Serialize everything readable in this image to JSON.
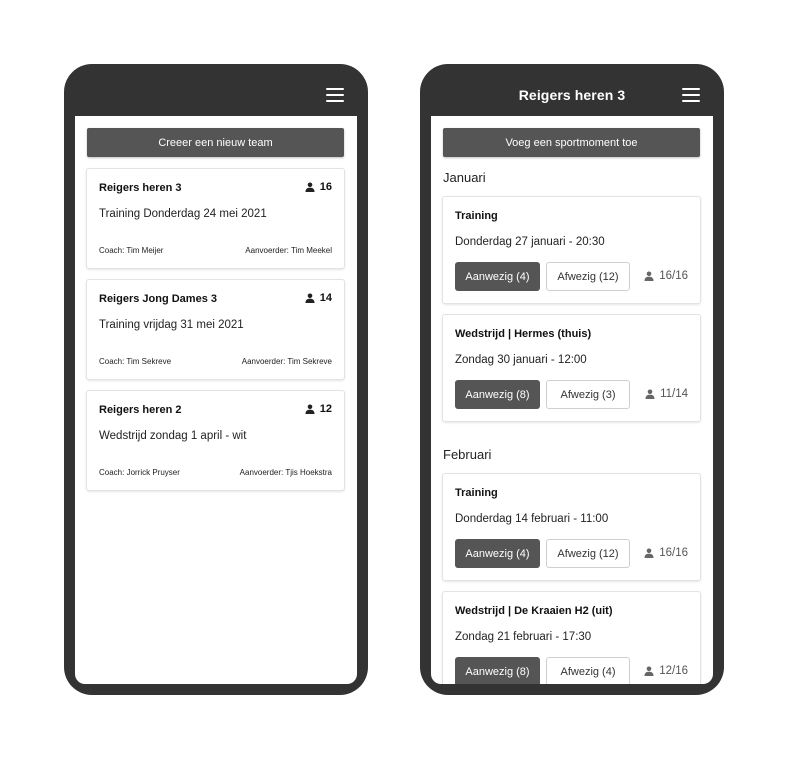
{
  "left_phone": {
    "new_team_label": "Creeer een nieuw team",
    "teams": [
      {
        "name": "Reigers heren 3",
        "members": "16",
        "event": "Training Donderdag 24 mei 2021",
        "coach": "Coach: Tim Meijer",
        "captain": "Aanvoerder: Tim Meekel"
      },
      {
        "name": "Reigers Jong Dames 3",
        "members": "14",
        "event": "Training vrijdag 31 mei 2021",
        "coach": "Coach: Tim Sekreve",
        "captain": "Aanvoerder: Tim Sekreve"
      },
      {
        "name": "Reigers heren 2",
        "members": "12",
        "event": "Wedstrijd zondag 1 april - wit",
        "coach": "Coach: Jorrick Pruyser",
        "captain": "Aanvoerder: Tjis Hoekstra"
      }
    ]
  },
  "right_phone": {
    "title": "Reigers heren 3",
    "add_moment_label": "Voeg een sportmoment toe",
    "months": [
      {
        "name": "Januari",
        "events": [
          {
            "title": "Training",
            "date": "Donderdag 27 januari - 20:30",
            "present": "Aanwezig (4)",
            "absent": "Afwezig (12)",
            "attendance": "16/16"
          },
          {
            "title": "Wedstrijd | Hermes (thuis)",
            "date": "Zondag 30 januari - 12:00",
            "present": "Aanwezig (8)",
            "absent": "Afwezig (3)",
            "attendance": "11/14"
          }
        ]
      },
      {
        "name": "Februari",
        "events": [
          {
            "title": "Training",
            "date": "Donderdag 14 februari - 11:00",
            "present": "Aanwezig (4)",
            "absent": "Afwezig (12)",
            "attendance": "16/16"
          },
          {
            "title": "Wedstrijd | De Kraaien H2 (uit)",
            "date": "Zondag 21 februari - 17:30",
            "present": "Aanwezig (8)",
            "absent": "Afwezig (4)",
            "attendance": "12/16"
          }
        ]
      }
    ]
  },
  "colors": {
    "phone_frame": "#333333",
    "primary_button": "#555555",
    "screen_background": "#ffffff"
  },
  "icons": {
    "menu": "hamburger-menu-icon",
    "members": "person-icon"
  }
}
